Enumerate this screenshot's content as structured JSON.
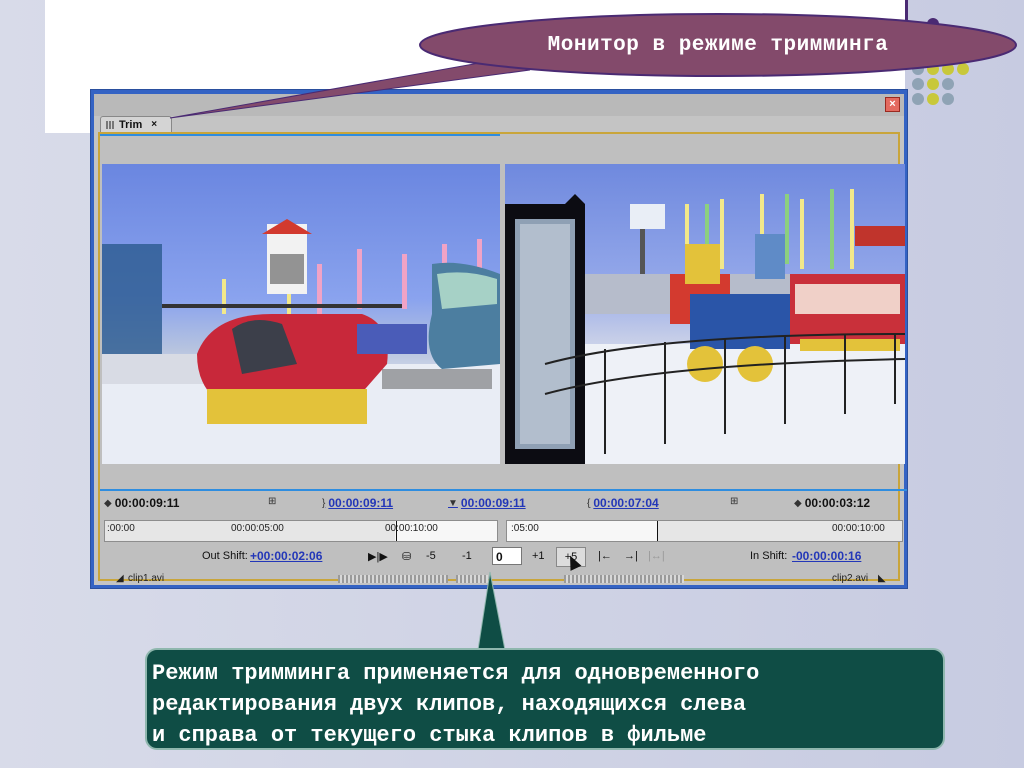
{
  "callouts": {
    "top": "Монитор в режиме тримминга",
    "bottom": "Режим тримминга применяется для одновременного\nредактирования двух клипов, находящихся слева\nи справа от текущего стыка клипов в фильме"
  },
  "window": {
    "tab_label": "Trim",
    "tab_close": "×",
    "close_glyph": "×"
  },
  "timecodes": {
    "left_current": "00:00:09:11",
    "left_out": "00:00:09:11",
    "left_marker": "00:00:09:11",
    "right_in": "00:00:07:04",
    "right_current": "00:00:03:12"
  },
  "rulers": {
    "left": [
      ":00:00",
      "00:00:05:00",
      "00:00:10:00"
    ],
    "right": [
      ":05:00",
      "00:00:10:00"
    ]
  },
  "controls": {
    "out_shift_label": "Out Shift:",
    "out_shift_value": "+00:00:02:06",
    "minus5": "-5",
    "minus1": "-1",
    "trim_value": "0",
    "plus1": "+1",
    "plus5": "+5",
    "in_shift_label": "In Shift:",
    "in_shift_value": "-00:00:00:16"
  },
  "clips": {
    "left": "clip1.avi",
    "right": "clip2.avi"
  },
  "colors": {
    "callout_top_fill": "#834a6b",
    "callout_bottom_fill": "#0f4d45",
    "window_frame": "#3463c4",
    "highlight_frame": "#c9a53a",
    "link_blue": "#2337b8"
  }
}
